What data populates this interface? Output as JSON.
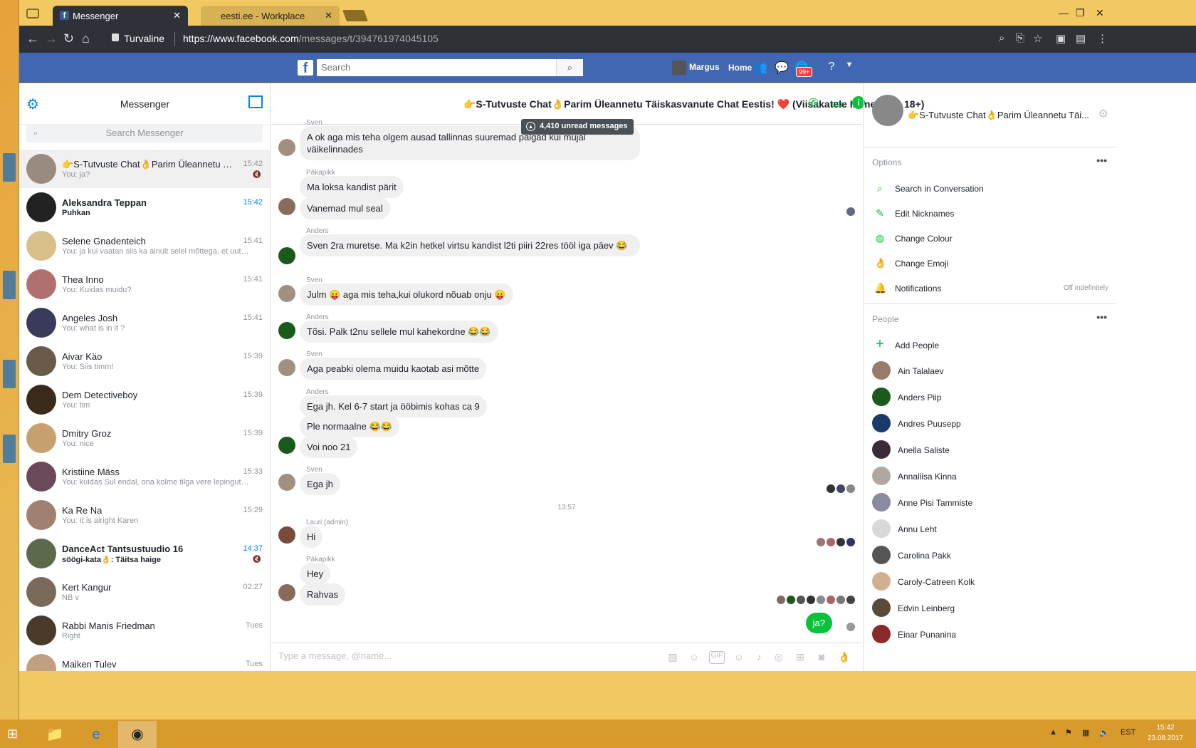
{
  "browser": {
    "tabs": [
      {
        "label": "Messenger",
        "active": true
      },
      {
        "label": "eesti.ee - Workplace",
        "active": false
      }
    ],
    "secure_label": "Turvaline",
    "url_host": "https://www.facebook.com",
    "url_path": "/messages/t/394761974045105"
  },
  "fb": {
    "logo": "f",
    "search_placeholder": "Search",
    "user": "Margus",
    "home": "Home",
    "notif_badge": "99+"
  },
  "messenger": {
    "title": "Messenger",
    "search_placeholder": "Search Messenger",
    "conversations": [
      {
        "name": "👉S-Tutvuste Chat👌Parim Üleannetu Täisk...",
        "snippet": "You: ja?",
        "time": "15:42",
        "active": true,
        "unread": false,
        "muted": true,
        "color": "#9a8b80"
      },
      {
        "name": "Aleksandra Teppan",
        "snippet": "Puhkan",
        "time": "15:42",
        "active": false,
        "unread": true,
        "muted": false,
        "color": "#222"
      },
      {
        "name": "Selene Gnadenteich",
        "snippet": "You: ja kui vaatan siis ka ainult selel mõttega, et uut õ...",
        "time": "15:41",
        "active": false,
        "unread": false,
        "muted": false,
        "color": "#d8c08a"
      },
      {
        "name": "Thea Inno",
        "snippet": "You: Kuidas muidu?",
        "time": "15:41",
        "active": false,
        "unread": false,
        "muted": false,
        "color": "#b07070"
      },
      {
        "name": "Angeles Josh",
        "snippet": "You: what is in it ?",
        "time": "15:41",
        "active": false,
        "unread": false,
        "muted": false,
        "color": "#3a3a5a"
      },
      {
        "name": "Aivar Käo",
        "snippet": "You: Siis timm!",
        "time": "15:39",
        "active": false,
        "unread": false,
        "muted": false,
        "color": "#6a5a4a"
      },
      {
        "name": "Dem Detectiveboy",
        "snippet": "You: tim",
        "time": "15:39",
        "active": false,
        "unread": false,
        "muted": false,
        "color": "#3a2a1a"
      },
      {
        "name": "Dmitry Groz",
        "snippet": "You: nice",
        "time": "15:39",
        "active": false,
        "unread": false,
        "muted": false,
        "color": "#c8a070"
      },
      {
        "name": "Kristiine Mäss",
        "snippet": "You: kuidas Sul endal, ona kolme tilga vere lepingute...",
        "time": "15:33",
        "active": false,
        "unread": false,
        "muted": false,
        "color": "#6a4a5a"
      },
      {
        "name": "Ka Re Na",
        "snippet": "You: It is alright Karen",
        "time": "15:29",
        "active": false,
        "unread": false,
        "muted": false,
        "color": "#a08070"
      },
      {
        "name": "DanceAct Tantsustuudio 16",
        "snippet": "söögi-kata👌: Täitsa haige",
        "time": "14:37",
        "active": false,
        "unread": true,
        "muted": true,
        "color": "#5a6a4a"
      },
      {
        "name": "Kert Kangur",
        "snippet": "NB v",
        "time": "02:27",
        "active": false,
        "unread": false,
        "muted": false,
        "color": "#7a6a5a"
      },
      {
        "name": "Rabbi Manis Friedman",
        "snippet": "Right",
        "time": "Tues",
        "active": false,
        "unread": false,
        "muted": false,
        "color": "#4a3a2a"
      },
      {
        "name": "Maiken Tulev",
        "snippet": "",
        "time": "Tues",
        "active": false,
        "unread": false,
        "muted": false,
        "color": "#c0a080"
      }
    ]
  },
  "chat": {
    "title": "👉S-Tutvuste Chat👌Parim Üleannetu Täiskasvanute Chat Eestis! ❤️ (Viisakatele Inimestele, 18+)",
    "unread_pill": "4,410 unread messages",
    "senders": {
      "s1": "Sven",
      "s2": "Päkapikk",
      "s3": "Anders",
      "s4": "Sven",
      "s5": "Anders",
      "s6": "Sven",
      "s7": "Anders",
      "s8": "Sven",
      "s9": "Lauri (admin)",
      "s10": "Päkapikk"
    },
    "messages": {
      "m1": "A ok aga mis teha olgem ausad tallinnas suuremad palgad kui mujal väikelinnades",
      "m2": "Ma loksa kandist pärit",
      "m3": "Vanemad mul seal",
      "m4": "Sven 2ra muretse. Ma k2in hetkel virtsu kandist l2ti piiri 22res tööl iga päev 😂",
      "m5": "Julm 😛 aga mis teha,kui olukord nõuab onju 😛",
      "m6": "Tõsi. Palk t2nu sellele mul kahekordne 😂😂",
      "m7": "Aga peabki olema muidu kaotab asi mõtte",
      "m8": "Ega jh. Kel 6-7 start ja ööbimis kohas ca 9",
      "m9": "Ple normaalne 😂😂",
      "m10": "Voi noo 21",
      "m11": "Ega jh",
      "m12": "Hi",
      "m13": "Hey",
      "m14": "Rahvas",
      "mine": "ja?"
    },
    "timestamp": "13:57",
    "composer_placeholder": "Type a message, @name..."
  },
  "details": {
    "name": "👉S-Tutvuste Chat👌Parim Üleannetu Täi...",
    "options_label": "Options",
    "options": [
      {
        "label": "Search in Conversation",
        "icon": "search-icon",
        "right": ""
      },
      {
        "label": "Edit Nicknames",
        "icon": "pencil-icon",
        "right": ""
      },
      {
        "label": "Change Colour",
        "icon": "palette-icon",
        "right": ""
      },
      {
        "label": "Change Emoji",
        "icon": "emoji-icon",
        "right": ""
      },
      {
        "label": "Notifications",
        "icon": "bell-icon",
        "right": "Off indefinitely"
      }
    ],
    "people_label": "People",
    "add_people": "Add People",
    "people": [
      {
        "name": "Ain Talalaev",
        "color": "#9a7a6a"
      },
      {
        "name": "Anders Piip",
        "color": "#1a5a1a"
      },
      {
        "name": "Andres Puusepp",
        "color": "#1a3a6a"
      },
      {
        "name": "Anella Saliste",
        "color": "#3a2a3a"
      },
      {
        "name": "Annaliisa Kinna",
        "color": "#b0a8a0"
      },
      {
        "name": "Anne Pisi Tammiste",
        "color": "#8a8aa0"
      },
      {
        "name": "Annu Leht",
        "color": "#d8d8d8"
      },
      {
        "name": "Carolina Pakk",
        "color": "#555"
      },
      {
        "name": "Caroly-Catreen Kolk",
        "color": "#d0b090"
      },
      {
        "name": "Edvin Leinberg",
        "color": "#5a4a3a"
      },
      {
        "name": "Einar Punanina",
        "color": "#8a2a2a"
      }
    ]
  },
  "taskbar": {
    "lang": "EST",
    "time": "15:42",
    "date": "23.08.2017"
  }
}
